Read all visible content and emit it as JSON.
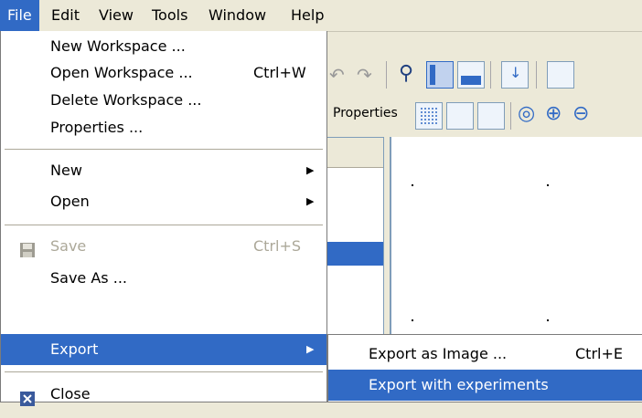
{
  "menubar": {
    "items": [
      {
        "label": "File",
        "active": true
      },
      {
        "label": "Edit"
      },
      {
        "label": "View"
      },
      {
        "label": "Tools"
      },
      {
        "label": "Window"
      },
      {
        "label": "Help"
      }
    ]
  },
  "toolbar": {
    "properties_label": "Properties"
  },
  "file_menu": {
    "new_workspace": "New Workspace ...",
    "open_workspace": "Open Workspace ...",
    "open_workspace_shortcut": "Ctrl+W",
    "delete_workspace": "Delete Workspace ...",
    "properties": "Properties ...",
    "new": "New",
    "open": "Open",
    "save": "Save",
    "save_shortcut": "Ctrl+S",
    "save_as": "Save As ...",
    "export": "Export",
    "close": "Close"
  },
  "export_submenu": {
    "export_as_image": "Export as Image ...",
    "export_as_image_shortcut": "Ctrl+E",
    "export_with_experiments": "Export with experiments"
  },
  "colors": {
    "highlight": "#316ac5",
    "menu_bg": "#ffffff",
    "chrome": "#ece9d8",
    "disabled_text": "#aca899"
  }
}
